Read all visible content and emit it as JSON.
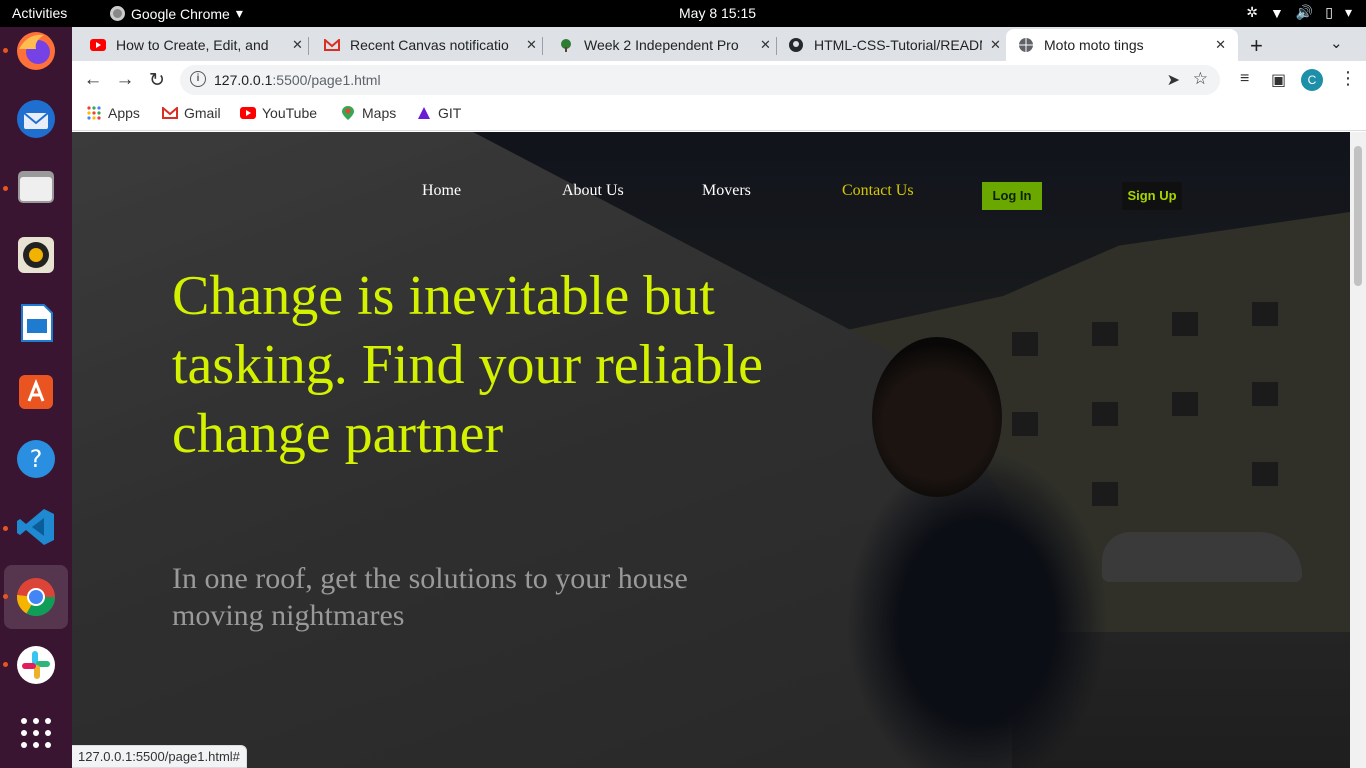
{
  "topbar": {
    "activities": "Activities",
    "app_name": "Google Chrome",
    "clock": "May 8  15:15"
  },
  "dock": {
    "items": [
      "firefox-icon",
      "thunderbird-icon",
      "files-icon",
      "rhythmbox-icon",
      "libreoffice-writer-icon",
      "software-center-icon",
      "help-icon",
      "vscode-icon",
      "chrome-icon",
      "slack-icon",
      "app-grid-icon"
    ]
  },
  "tabs": [
    {
      "title": "How to Create, Edit, and",
      "favicon_color": "#ff0000"
    },
    {
      "title": "Recent Canvas notificatio",
      "favicon_color": "#d93025"
    },
    {
      "title": "Week 2 Independent Pro",
      "favicon_color": "#2e7d32"
    },
    {
      "title": "HTML-CSS-Tutorial/README",
      "favicon_color": "#24292e"
    },
    {
      "title": "Moto moto tings",
      "favicon_color": "#5f6368"
    }
  ],
  "address_bar": {
    "host": "127.0.0.1",
    "path": ":5500/page1.html"
  },
  "bookmarks": [
    {
      "label": "Apps"
    },
    {
      "label": "Gmail"
    },
    {
      "label": "YouTube"
    },
    {
      "label": "Maps"
    },
    {
      "label": "GIT"
    }
  ],
  "profile_initial": "C",
  "page": {
    "nav": {
      "home": "Home",
      "about": "About Us",
      "movers": "Movers",
      "contact": "Contact Us",
      "login": "Log In",
      "signup": "Sign Up"
    },
    "hero_title": "Change is inevitable but tasking. Find your reliable change partner",
    "hero_subtitle": "In one roof, get the solutions to your house moving nightmares",
    "colors": {
      "hero_text": "#d4f200",
      "contact_link": "#d6c800",
      "login_bg": "#6aa800"
    }
  },
  "status_url": "127.0.0.1:5500/page1.html#"
}
